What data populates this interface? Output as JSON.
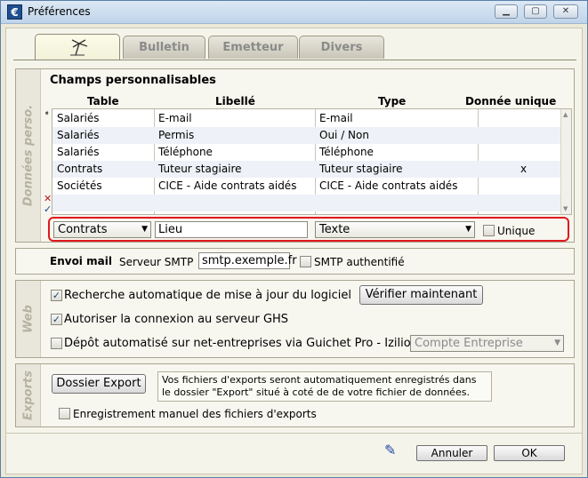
{
  "window": {
    "title": "Préférences",
    "app_icon": "app-logo-icon"
  },
  "tabs": [
    {
      "label": "",
      "icon": "palm-tree-icon",
      "active": true
    },
    {
      "label": "Bulletin",
      "active": false
    },
    {
      "label": "Emetteur",
      "active": false
    },
    {
      "label": "Divers",
      "active": false
    }
  ],
  "donnees_perso": {
    "side_label": "Données perso.",
    "section_title": "Champs personnalisables",
    "columns": [
      "Table",
      "Libellé",
      "Type",
      "Donnée unique"
    ],
    "rows": [
      {
        "table": "Salariés",
        "libelle": "E-mail",
        "type": "E-mail",
        "unique": ""
      },
      {
        "table": "Salariés",
        "libelle": "Permis",
        "type": "Oui / Non",
        "unique": ""
      },
      {
        "table": "Salariés",
        "libelle": "Téléphone",
        "type": "Téléphone",
        "unique": ""
      },
      {
        "table": "Contrats",
        "libelle": "Tuteur stagiaire",
        "type": "Tuteur stagiaire",
        "unique": "x"
      },
      {
        "table": "Sociétés",
        "libelle": "CICE - Aide contrats aidés",
        "type": "CICE - Aide contrats aidés",
        "unique": ""
      }
    ],
    "new_row": {
      "table_value": "Contrats",
      "libelle_value": "Lieu",
      "type_value": "Texte",
      "unique_label": "Unique",
      "unique_checked": false
    }
  },
  "envoi_mail": {
    "title": "Envoi mail",
    "smtp_label": "Serveur SMTP",
    "smtp_value": "smtp.exemple.fr",
    "auth_label": "SMTP authentifié",
    "auth_checked": false
  },
  "web": {
    "side_label": "Web",
    "auto_update_label": "Recherche automatique de mise à jour du logiciel",
    "auto_update_checked": true,
    "verify_button": "Vérifier maintenant",
    "ghs_label": "Autoriser la connexion au serveur GHS",
    "ghs_checked": true,
    "depot_label": "Dépôt automatisé sur net-entreprises via Guichet Pro - Izilio",
    "depot_checked": false,
    "account_value": "Compte Entreprise"
  },
  "exports": {
    "side_label": "Exports",
    "folder_button": "Dossier Export",
    "info_line1": "Vos fichiers d'exports seront automatiquement enregistrés dans",
    "info_line2": "le dossier \"Export\" situé à coté de de votre fichier de données.",
    "manual_label": "Enregistrement manuel des fichiers d'exports",
    "manual_checked": false
  },
  "footer": {
    "cancel_label": "Annuler",
    "ok_label": "OK"
  }
}
